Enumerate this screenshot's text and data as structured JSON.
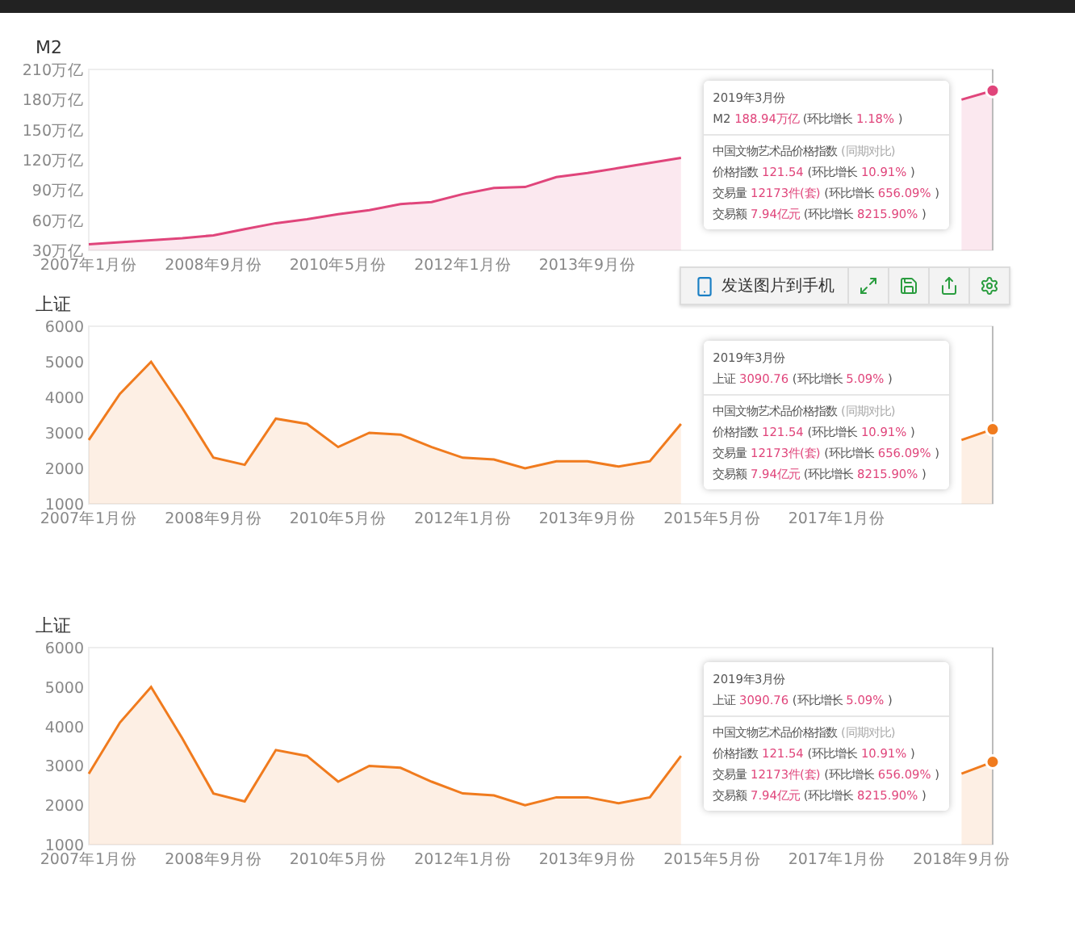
{
  "panels": [
    {
      "chart_data": {
        "type": "area",
        "title": "M2",
        "categories": [
          "2007年1月份",
          null,
          null,
          null,
          "2008年9月份",
          null,
          null,
          null,
          "2010年5月份",
          null,
          null,
          null,
          "2012年1月份",
          null,
          null,
          null,
          "2013年9月份",
          null,
          null,
          null,
          null,
          null,
          null,
          null,
          null,
          null,
          null,
          null,
          null,
          null
        ],
        "series": [
          {
            "color": "#e0457b",
            "values": [
              36,
              38,
              40,
              42,
              45,
              51,
              57,
              61,
              66,
              70,
              76,
              78,
              86,
              92,
              93,
              103,
              107,
              112,
              117,
              122,
              null,
              null,
              null,
              null,
              null,
              null,
              null,
              null,
              180,
              189
            ]
          }
        ],
        "ylim": [
          30,
          210
        ],
        "yticks": [
          {
            "value": 30,
            "label": "30万亿"
          },
          {
            "value": 60,
            "label": "60万亿"
          },
          {
            "value": 90,
            "label": "90万亿"
          },
          {
            "value": 120,
            "label": "120万亿"
          },
          {
            "value": 150,
            "label": "150万亿"
          },
          {
            "value": 180,
            "label": "180万亿"
          },
          {
            "value": 210,
            "label": "210万亿"
          }
        ]
      },
      "tooltip": {
        "header_lines": [
          [
            {
              "kind": "plain",
              "text": "2019年3月份"
            }
          ],
          [
            {
              "kind": "plain",
              "text": "M2"
            },
            {
              "kind": "value",
              "text": "188.94万亿"
            },
            {
              "kind": "plain",
              "text": "(环比增长"
            },
            {
              "kind": "value",
              "text": "1.18%"
            },
            {
              "kind": "plain",
              "text": ")"
            }
          ]
        ],
        "body_lines": [
          [
            {
              "kind": "plain",
              "text": "中国文物艺术品价格指数"
            },
            {
              "kind": "muted",
              "text": "(同期对比)"
            }
          ],
          [
            {
              "kind": "plain",
              "text": "价格指数"
            },
            {
              "kind": "value",
              "text": "121.54"
            },
            {
              "kind": "plain",
              "text": "(环比增长"
            },
            {
              "kind": "value",
              "text": "10.91%"
            },
            {
              "kind": "plain",
              "text": ")"
            }
          ],
          [
            {
              "kind": "plain",
              "text": "交易量"
            },
            {
              "kind": "value",
              "text": "12173件(套)"
            },
            {
              "kind": "plain",
              "text": "(环比增长"
            },
            {
              "kind": "value",
              "text": "656.09%"
            },
            {
              "kind": "plain",
              "text": ")"
            }
          ],
          [
            {
              "kind": "plain",
              "text": "交易额"
            },
            {
              "kind": "value",
              "text": "7.94亿元"
            },
            {
              "kind": "plain",
              "text": "(环比增长"
            },
            {
              "kind": "value",
              "text": "8215.90%"
            },
            {
              "kind": "plain",
              "text": ")"
            }
          ]
        ]
      },
      "toolbar": [
        {
          "kind": "send",
          "label": "发送图片到手机"
        },
        {
          "kind": "fullscreen"
        },
        {
          "kind": "save"
        },
        {
          "kind": "share"
        },
        {
          "kind": "settings"
        }
      ]
    },
    {
      "chart_data": {
        "type": "area",
        "title": "上证",
        "categories": [
          "2007年1月份",
          null,
          null,
          null,
          "2008年9月份",
          null,
          null,
          null,
          "2010年5月份",
          null,
          null,
          null,
          "2012年1月份",
          null,
          null,
          null,
          "2013年9月份",
          null,
          null,
          null,
          "2015年5月份",
          null,
          null,
          null,
          "2017年1月份",
          null,
          null,
          null,
          null,
          null
        ],
        "series": [
          {
            "color": "#f07b1e",
            "values": [
              2800,
              4100,
              5000,
              3700,
              2300,
              2100,
              3400,
              3250,
              2600,
              3000,
              2950,
              2600,
              2300,
              2250,
              2000,
              2200,
              2200,
              2050,
              2200,
              3250,
              null,
              null,
              null,
              null,
              null,
              null,
              null,
              null,
              2800,
              3100
            ]
          }
        ],
        "ylim": [
          1000,
          6000
        ],
        "yticks": [
          1000,
          2000,
          3000,
          4000,
          5000,
          6000
        ]
      },
      "tooltip": {
        "header_lines": [
          [
            {
              "kind": "plain",
              "text": "2019年3月份"
            }
          ],
          [
            {
              "kind": "plain",
              "text": "上证"
            },
            {
              "kind": "value",
              "text": "3090.76"
            },
            {
              "kind": "plain",
              "text": "(环比增长"
            },
            {
              "kind": "value",
              "text": "5.09%"
            },
            {
              "kind": "plain",
              "text": ")"
            }
          ]
        ],
        "body_lines": [
          [
            {
              "kind": "plain",
              "text": "中国文物艺术品价格指数"
            },
            {
              "kind": "muted",
              "text": "(同期对比)"
            }
          ],
          [
            {
              "kind": "plain",
              "text": "价格指数"
            },
            {
              "kind": "value",
              "text": "121.54"
            },
            {
              "kind": "plain",
              "text": "(环比增长"
            },
            {
              "kind": "value",
              "text": "10.91%"
            },
            {
              "kind": "plain",
              "text": ")"
            }
          ],
          [
            {
              "kind": "plain",
              "text": "交易量"
            },
            {
              "kind": "value",
              "text": "12173件(套)"
            },
            {
              "kind": "plain",
              "text": "(环比增长"
            },
            {
              "kind": "value",
              "text": "656.09%"
            },
            {
              "kind": "plain",
              "text": ")"
            }
          ],
          [
            {
              "kind": "plain",
              "text": "交易额"
            },
            {
              "kind": "value",
              "text": "7.94亿元"
            },
            {
              "kind": "plain",
              "text": "(环比增长"
            },
            {
              "kind": "value",
              "text": "8215.90%"
            },
            {
              "kind": "plain",
              "text": ")"
            }
          ]
        ]
      }
    },
    {
      "chart_data": {
        "type": "area",
        "title": "上证",
        "categories": [
          "2007年1月份",
          null,
          null,
          null,
          "2008年9月份",
          null,
          null,
          null,
          "2010年5月份",
          null,
          null,
          null,
          "2012年1月份",
          null,
          null,
          null,
          "2013年9月份",
          null,
          null,
          null,
          "2015年5月份",
          null,
          null,
          null,
          "2017年1月份",
          null,
          null,
          null,
          "2018年9月份",
          null
        ],
        "series": [
          {
            "color": "#f07b1e",
            "values": [
              2800,
              4100,
              5000,
              3700,
              2300,
              2100,
              3400,
              3250,
              2600,
              3000,
              2950,
              2600,
              2300,
              2250,
              2000,
              2200,
              2200,
              2050,
              2200,
              3250,
              null,
              null,
              null,
              null,
              null,
              null,
              null,
              null,
              2800,
              3100
            ]
          }
        ],
        "ylim": [
          1000,
          6000
        ],
        "yticks": [
          1000,
          2000,
          3000,
          4000,
          5000,
          6000
        ]
      },
      "tooltip": {
        "header_lines": [
          [
            {
              "kind": "plain",
              "text": "2019年3月份"
            }
          ],
          [
            {
              "kind": "plain",
              "text": "上证"
            },
            {
              "kind": "value",
              "text": "3090.76"
            },
            {
              "kind": "plain",
              "text": "(环比增长"
            },
            {
              "kind": "value",
              "text": "5.09%"
            },
            {
              "kind": "plain",
              "text": ")"
            }
          ]
        ],
        "body_lines": [
          [
            {
              "kind": "plain",
              "text": "中国文物艺术品价格指数"
            },
            {
              "kind": "muted",
              "text": "(同期对比)"
            }
          ],
          [
            {
              "kind": "plain",
              "text": "价格指数"
            },
            {
              "kind": "value",
              "text": "121.54"
            },
            {
              "kind": "plain",
              "text": "(环比增长"
            },
            {
              "kind": "value",
              "text": "10.91%"
            },
            {
              "kind": "plain",
              "text": ")"
            }
          ],
          [
            {
              "kind": "plain",
              "text": "交易量"
            },
            {
              "kind": "value",
              "text": "12173件(套)"
            },
            {
              "kind": "plain",
              "text": "(环比增长"
            },
            {
              "kind": "value",
              "text": "656.09%"
            },
            {
              "kind": "plain",
              "text": ")"
            }
          ],
          [
            {
              "kind": "plain",
              "text": "交易额"
            },
            {
              "kind": "value",
              "text": "7.94亿元"
            },
            {
              "kind": "plain",
              "text": "(环比增长"
            },
            {
              "kind": "value",
              "text": "8215.90%"
            },
            {
              "kind": "plain",
              "text": ")"
            }
          ]
        ]
      }
    }
  ]
}
